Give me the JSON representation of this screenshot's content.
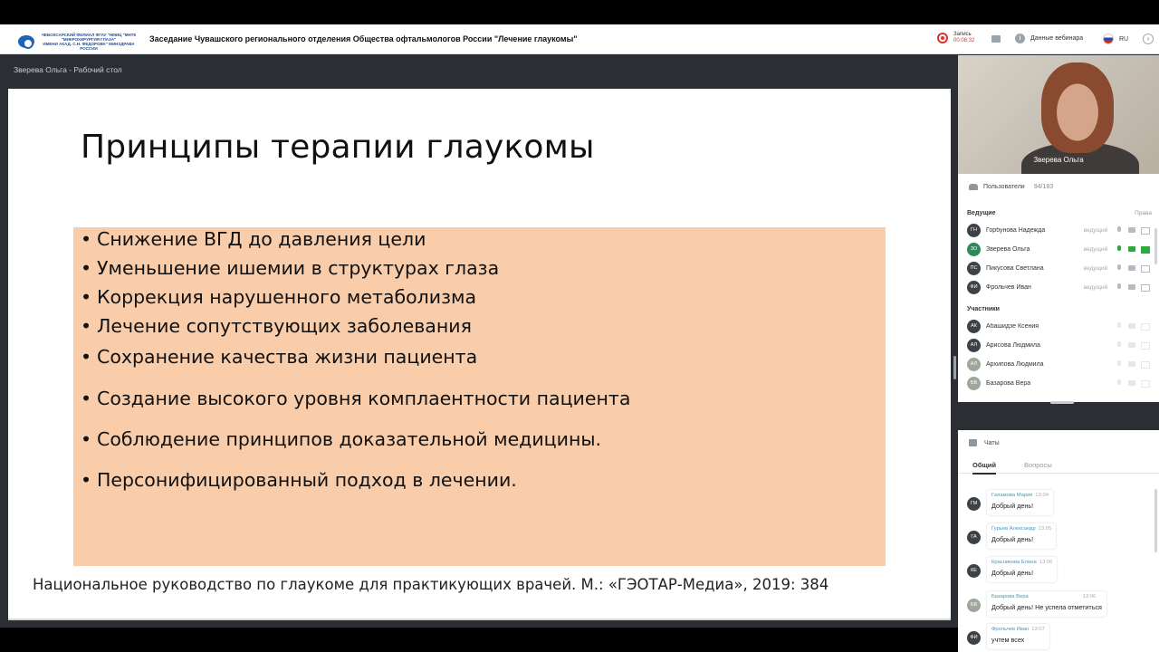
{
  "header": {
    "logo_lines": [
      "ЧЕБОКСАРСКИЙ ФИЛИАЛ ФГАУ \"НМИЦ \"МНТК",
      "\"МИКРОХИРУРГИЯ ГЛАЗА\"",
      "ИМЕНИ АКАД. С.Н. ФЕДОРОВА\" МИНЗДРАВА РОССИИ"
    ],
    "title": "Заседание Чувашского регионального отделения Общества офтальмологов России \"Лечение глаукомы\"",
    "record_label": "Запись",
    "record_time": "00:08:32",
    "webinar_data": "Данные вебинара",
    "language": "RU"
  },
  "presenter_label": "Зверева Ольга - Рабочий стол",
  "slide": {
    "title": "Принципы  терапии глаукомы",
    "bullet_char": "•",
    "bullets": [
      "Снижение ВГД до давления цели",
      "Уменьшение ишемии в структурах глаза",
      "Коррекция нарушенного метаболизма",
      "Лечение сопутствующих заболевания",
      "Сохранение качества жизни пациента",
      "Создание высокого уровня комплаентности пациента",
      "Соблюдение принципов доказательной медицины.",
      "Персонифицированный подход в лечении."
    ],
    "citation": "Национальное руководство по глаукоме для практикующих врачей. М.: «ГЭОТАР-Медиа», 2019: 384"
  },
  "video": {
    "name": "Зверева Ольга"
  },
  "users": {
    "title": "Пользователи",
    "count": "94/183",
    "hosts_label": "Ведущие",
    "rights_label": "Права",
    "hosts": [
      {
        "initials": "ГН",
        "name": "Горбунова Надежда",
        "role": "ведущий"
      },
      {
        "initials": "ЗО",
        "name": "Зверева Ольга",
        "role": "ведущий"
      },
      {
        "initials": "ПС",
        "name": "Пикусова Светлана",
        "role": "ведущий"
      },
      {
        "initials": "ФИ",
        "name": "Фрольчев Иван",
        "role": "ведущий"
      }
    ],
    "participants_label": "Участники",
    "participants": [
      {
        "initials": "АК",
        "name": "Абашидзе Ксения"
      },
      {
        "initials": "АЛ",
        "name": "Арисова Людмила"
      },
      {
        "initials": "АЛ",
        "name": "Архипова Людмила"
      },
      {
        "initials": "БВ",
        "name": "Базарова Вера"
      }
    ]
  },
  "chats": {
    "title": "Чаты",
    "tabs": [
      "Общий",
      "Вопросы"
    ],
    "messages": [
      {
        "initials": "ГМ",
        "author": "Галамова Мария",
        "time": "13:04",
        "text": "Добрый день!"
      },
      {
        "initials": "ГА",
        "author": "Гурьев Александр",
        "time": "13:05",
        "text": "Добрый день!"
      },
      {
        "initials": "КЕ",
        "author": "Красникова Елена",
        "time": "13:06",
        "text": "Добрый день!"
      },
      {
        "initials": "БВ",
        "author": "Базарова Вера",
        "time": "13:06",
        "text": "Добрый день! Не успела отметиться"
      },
      {
        "initials": "ФИ",
        "author": "Фрольчев Иван",
        "time": "13:07",
        "text": "учтем всех"
      }
    ]
  }
}
